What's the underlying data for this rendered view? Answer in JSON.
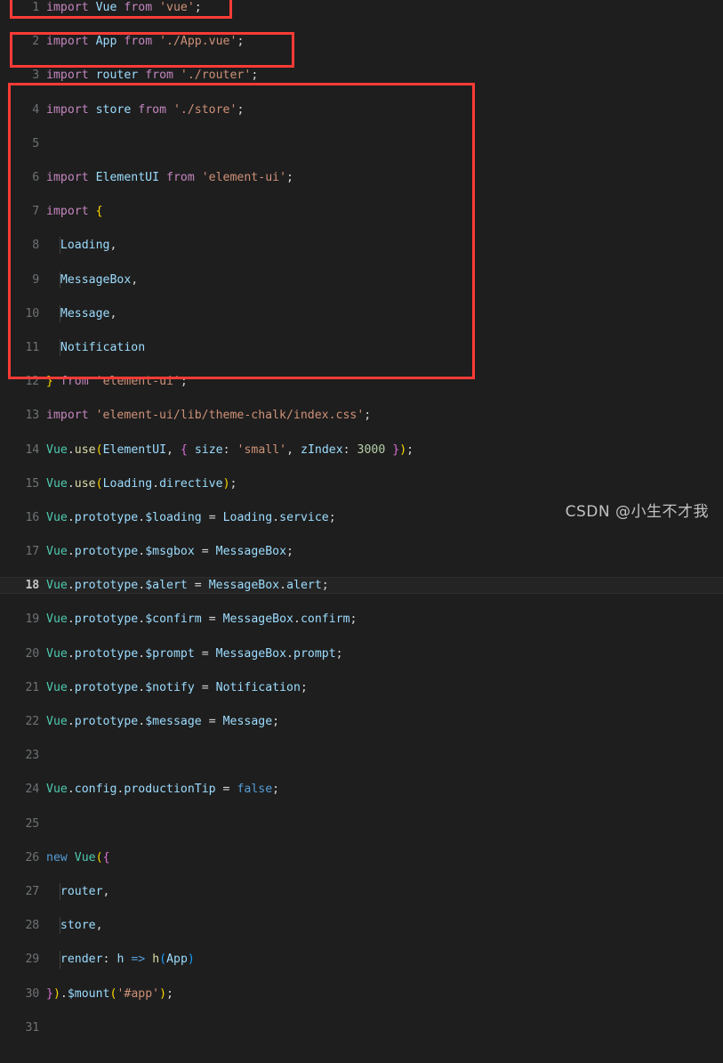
{
  "editor": {
    "theme": "dark-plus",
    "background": "#1e1e1e",
    "active_line": 18,
    "total_lines_visible": 31,
    "gutter_color": "#6e7275",
    "annotation_color": "#fd3b36"
  },
  "lines": [
    {
      "num": "1",
      "text": "import Vue from 'vue';"
    },
    {
      "num": "2",
      "text": "import App from './App.vue';"
    },
    {
      "num": "3",
      "text": "import router from './router';"
    },
    {
      "num": "4",
      "text": "import store from './store';"
    },
    {
      "num": "5",
      "text": ""
    },
    {
      "num": "6",
      "text": "import ElementUI from 'element-ui';"
    },
    {
      "num": "7",
      "text": "import {"
    },
    {
      "num": "8",
      "text": "  Loading,"
    },
    {
      "num": "9",
      "text": "  MessageBox,"
    },
    {
      "num": "10",
      "text": "  Message,"
    },
    {
      "num": "11",
      "text": "  Notification"
    },
    {
      "num": "12",
      "text": "} from 'element-ui';"
    },
    {
      "num": "13",
      "text": "import 'element-ui/lib/theme-chalk/index.css';"
    },
    {
      "num": "14",
      "text": "Vue.use(ElementUI, { size: 'small', zIndex: 3000 });"
    },
    {
      "num": "15",
      "text": "Vue.use(Loading.directive);"
    },
    {
      "num": "16",
      "text": "Vue.prototype.$loading = Loading.service;"
    },
    {
      "num": "17",
      "text": "Vue.prototype.$msgbox = MessageBox;"
    },
    {
      "num": "18",
      "text": "Vue.prototype.$alert = MessageBox.alert;"
    },
    {
      "num": "19",
      "text": "Vue.prototype.$confirm = MessageBox.confirm;"
    },
    {
      "num": "20",
      "text": "Vue.prototype.$prompt = MessageBox.prompt;"
    },
    {
      "num": "21",
      "text": "Vue.prototype.$notify = Notification;"
    },
    {
      "num": "22",
      "text": "Vue.prototype.$message = Message;"
    },
    {
      "num": "23",
      "text": ""
    },
    {
      "num": "24",
      "text": "Vue.config.productionTip = false;"
    },
    {
      "num": "25",
      "text": ""
    },
    {
      "num": "26",
      "text": "new Vue({"
    },
    {
      "num": "27",
      "text": "  router,"
    },
    {
      "num": "28",
      "text": "  store,"
    },
    {
      "num": "29",
      "text": "  render: h => h(App)"
    },
    {
      "num": "30",
      "text": "}).$mount('#app');"
    },
    {
      "num": "31",
      "text": ""
    }
  ],
  "annotations": [
    {
      "label": "highlight-box-line-1",
      "lines": "1",
      "color": "#fd3b36"
    },
    {
      "label": "highlight-box-lines-3-4",
      "lines": "3-4",
      "color": "#fd3b36"
    },
    {
      "label": "highlight-box-lines-6-22",
      "lines": "6-22",
      "color": "#fd3b36"
    }
  ],
  "watermark": {
    "text": "CSDN @小生不才我"
  }
}
